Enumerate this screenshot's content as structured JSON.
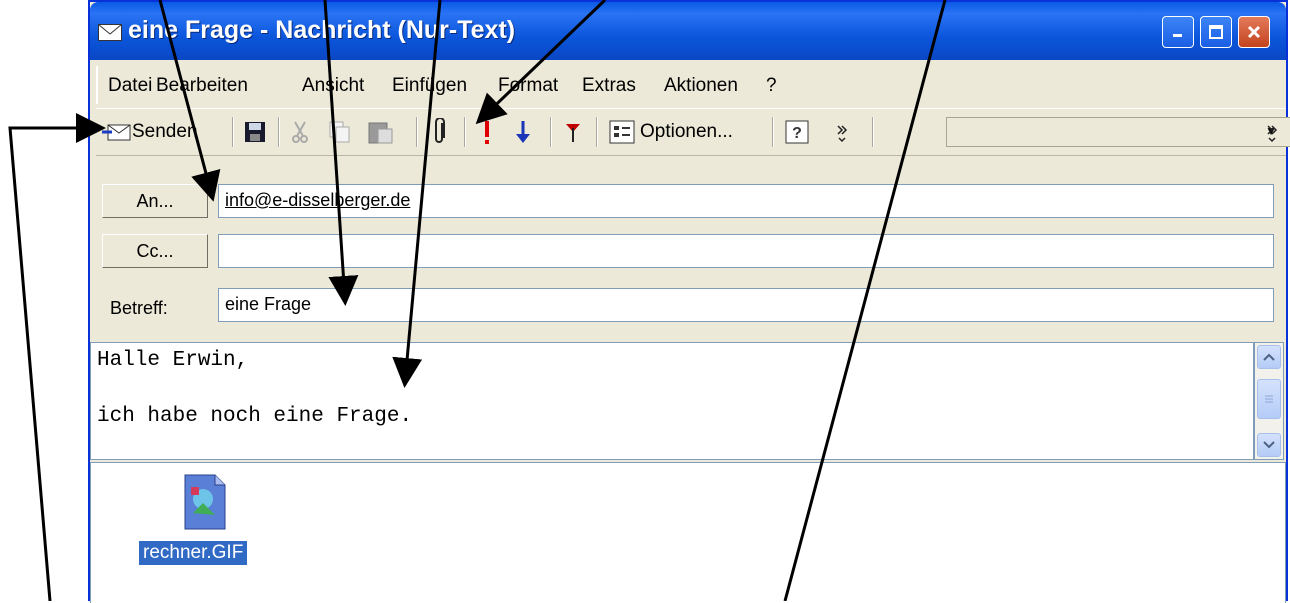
{
  "window": {
    "title": "eine Frage - Nachricht (Nur-Text)"
  },
  "menu": {
    "items": [
      "Datei",
      "Bearbeiten",
      "Ansicht",
      "Einfügen",
      "Format",
      "Extras",
      "Aktionen",
      "?"
    ]
  },
  "toolbar": {
    "send_label": "Senden",
    "options_label": "Optionen...",
    "combo_value": ""
  },
  "header": {
    "to_button": "An...",
    "cc_button": "Cc...",
    "subject_label": "Betreff:",
    "to_value": "info@e-disselberger.de",
    "cc_value": "",
    "subject_value": "eine Frage"
  },
  "body": {
    "lines": [
      "Halle Erwin,",
      "",
      "ich habe noch eine Frage."
    ]
  },
  "attachment": {
    "filename": "rechner.GIF"
  },
  "colors": {
    "titlebar": "#0a5ae5",
    "selection": "#316ac5",
    "field_border": "#7f9db9"
  }
}
